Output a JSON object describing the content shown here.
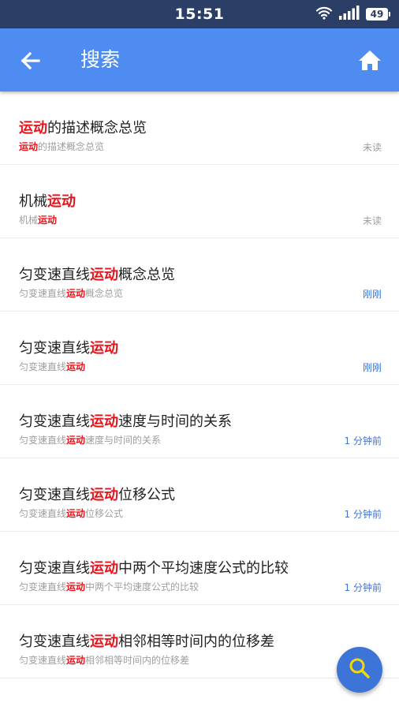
{
  "status_bar": {
    "time": "15:51",
    "battery": "49"
  },
  "app_bar": {
    "title": "搜索"
  },
  "search_term": "运动",
  "items": [
    {
      "title_pre": "",
      "title_hl": "运动",
      "title_post": "的描述概念总览",
      "sub_pre": "",
      "sub_hl": "运动",
      "sub_post": "的描述概念总览",
      "status": "未读",
      "status_type": "unread"
    },
    {
      "title_pre": "机械",
      "title_hl": "运动",
      "title_post": "",
      "sub_pre": "机械",
      "sub_hl": "运动",
      "sub_post": "",
      "status": "未读",
      "status_type": "unread"
    },
    {
      "title_pre": "匀变速直线",
      "title_hl": "运动",
      "title_post": "概念总览",
      "sub_pre": "匀变速直线",
      "sub_hl": "运动",
      "sub_post": "概念总览",
      "status": "刚刚",
      "status_type": "recent"
    },
    {
      "title_pre": "匀变速直线",
      "title_hl": "运动",
      "title_post": "",
      "sub_pre": "匀变速直线",
      "sub_hl": "运动",
      "sub_post": "",
      "status": "刚刚",
      "status_type": "recent"
    },
    {
      "title_pre": "匀变速直线",
      "title_hl": "运动",
      "title_post": "速度与时间的关系",
      "sub_pre": "匀变速直线",
      "sub_hl": "运动",
      "sub_post": "速度与时间的关系",
      "status": "1 分钟前",
      "status_type": "recent"
    },
    {
      "title_pre": "匀变速直线",
      "title_hl": "运动",
      "title_post": "位移公式",
      "sub_pre": "匀变速直线",
      "sub_hl": "运动",
      "sub_post": "位移公式",
      "status": "1 分钟前",
      "status_type": "recent"
    },
    {
      "title_pre": "匀变速直线",
      "title_hl": "运动",
      "title_post": "中两个平均速度公式的比较",
      "sub_pre": "匀变速直线",
      "sub_hl": "运动",
      "sub_post": "中两个平均速度公式的比较",
      "status": "1 分钟前",
      "status_type": "recent"
    },
    {
      "title_pre": "匀变速直线",
      "title_hl": "运动",
      "title_post": "相邻相等时间内的位移差",
      "sub_pre": "匀变速直线",
      "sub_hl": "运动",
      "sub_post": "相邻相等时间内的位移差",
      "status": "",
      "status_type": "recent"
    }
  ],
  "icons": {
    "back": "back-arrow-icon",
    "home": "home-icon",
    "search": "search-icon",
    "wifi": "wifi-icon",
    "signal": "signal-icon"
  },
  "colors": {
    "status_bar": "#2a3e66",
    "app_bar": "#4f8cf2",
    "highlight": "#e8141c",
    "accent": "#3c74d8"
  }
}
